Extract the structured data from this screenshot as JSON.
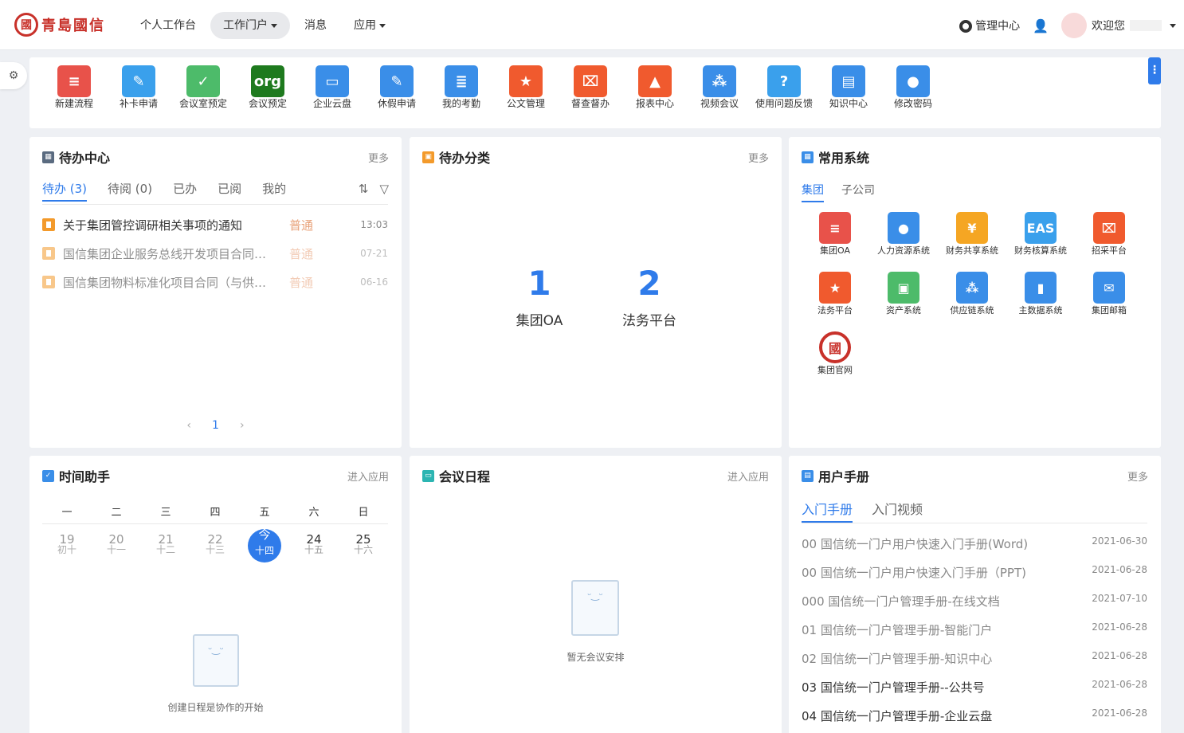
{
  "brand": {
    "seal": "國",
    "name": "青島國信"
  },
  "nav": [
    {
      "label": "个人工作台"
    },
    {
      "label": "工作门户",
      "active": true,
      "dropdown": true
    },
    {
      "label": "消息"
    },
    {
      "label": "应用",
      "dropdown": true
    }
  ],
  "top_right": {
    "admin": "管理中心",
    "welcome": "欢迎您"
  },
  "shortcuts": [
    {
      "label": "新建流程",
      "color": "#e8524a",
      "icon": "≡"
    },
    {
      "label": "补卡申请",
      "color": "#3aa0ec",
      "icon": "✎"
    },
    {
      "label": "会议室预定",
      "color": "#4dbb6a",
      "icon": "✓"
    },
    {
      "label": "会议预定",
      "color": "#1e7a1e",
      "icon": "org"
    },
    {
      "label": "企业云盘",
      "color": "#3a8ee8",
      "icon": "▭"
    },
    {
      "label": "休假申请",
      "color": "#3a8ee8",
      "icon": "✎"
    },
    {
      "label": "我的考勤",
      "color": "#3a8ee8",
      "icon": "≣"
    },
    {
      "label": "公文管理",
      "color": "#f05a2e",
      "icon": "★"
    },
    {
      "label": "督查督办",
      "color": "#f05a2e",
      "icon": "⌧"
    },
    {
      "label": "报表中心",
      "color": "#f05a2e",
      "icon": "▲"
    },
    {
      "label": "视频会议",
      "color": "#3a8ee8",
      "icon": "⁂"
    },
    {
      "label": "使用问题反馈",
      "color": "#3aa0ec",
      "icon": "?"
    },
    {
      "label": "知识中心",
      "color": "#3a8ee8",
      "icon": "▤"
    },
    {
      "label": "修改密码",
      "color": "#3a8ee8",
      "icon": "●"
    }
  ],
  "todo": {
    "title": "待办中心",
    "more": "更多",
    "tabs": [
      "待办 (3)",
      "待阅 (0)",
      "已办",
      "已阅",
      "我的"
    ],
    "rows": [
      {
        "text": "关于集团管控调研相关事项的通知",
        "level": "普通",
        "time": "13:03"
      },
      {
        "text": "国信集团企业服务总线开发项目合同执行情况",
        "level": "普通",
        "time": "07-21"
      },
      {
        "text": "国信集团物料标准化项目合同（与供应商签订）",
        "level": "普通",
        "time": "06-16"
      }
    ],
    "page": "1"
  },
  "category": {
    "title": "待办分类",
    "more": "更多",
    "items": [
      {
        "count": "1",
        "name": "集团OA"
      },
      {
        "count": "2",
        "name": "法务平台"
      }
    ]
  },
  "systems": {
    "title": "常用系统",
    "tabs": [
      "集团",
      "子公司"
    ],
    "items": [
      {
        "label": "集团OA",
        "color": "#e8524a",
        "icon": "≡"
      },
      {
        "label": "人力资源系统",
        "color": "#3a8ee8",
        "icon": "●"
      },
      {
        "label": "财务共享系统",
        "color": "#f5a623",
        "icon": "¥"
      },
      {
        "label": "财务核算系统",
        "color": "#3aa0ec",
        "icon": "EAS"
      },
      {
        "label": "招采平台",
        "color": "#f05a2e",
        "icon": "⌧"
      },
      {
        "label": "法务平台",
        "color": "#f05a2e",
        "icon": "★"
      },
      {
        "label": "资产系统",
        "color": "#4dbb6a",
        "icon": "▣"
      },
      {
        "label": "供应链系统",
        "color": "#3a8ee8",
        "icon": "⁂"
      },
      {
        "label": "主数据系统",
        "color": "#3a8ee8",
        "icon": "▮"
      },
      {
        "label": "集团邮箱",
        "color": "#3a8ee8",
        "icon": "✉"
      },
      {
        "label": "集团官网",
        "color": "#c8312a",
        "icon": "國",
        "seal": true
      }
    ]
  },
  "time": {
    "title": "时间助手",
    "more": "进入应用",
    "weekdays": [
      "一",
      "二",
      "三",
      "四",
      "五",
      "六",
      "日"
    ],
    "days": [
      {
        "d": "19",
        "l": "初十"
      },
      {
        "d": "20",
        "l": "十一"
      },
      {
        "d": "21",
        "l": "十二"
      },
      {
        "d": "22",
        "l": "十三"
      },
      {
        "d": "今",
        "l": "十四",
        "today": true
      },
      {
        "d": "24",
        "l": "十五",
        "future": true
      },
      {
        "d": "25",
        "l": "十六",
        "future": true
      }
    ],
    "empty": "创建日程是协作的开始"
  },
  "meeting": {
    "title": "会议日程",
    "more": "进入应用",
    "empty": "暂无会议安排"
  },
  "manual": {
    "title": "用户手册",
    "more": "更多",
    "tabs": [
      "入门手册",
      "入门视频"
    ],
    "rows": [
      {
        "text": "00 国信统一门户用户快速入门手册(Word)",
        "date": "2021-06-30"
      },
      {
        "text": "00 国信统一门户用户快速入门手册（PPT)",
        "date": "2021-06-28"
      },
      {
        "text": "000 国信统一门户管理手册-在线文档",
        "date": "2021-07-10"
      },
      {
        "text": "01 国信统一门户管理手册-智能门户",
        "date": "2021-06-28"
      },
      {
        "text": "02 国信统一门户管理手册-知识中心",
        "date": "2021-06-28"
      },
      {
        "text": "03 国信统一门户管理手册--公共号",
        "date": "2021-06-28",
        "dark": true
      },
      {
        "text": "04 国信统一门户管理手册-企业云盘",
        "date": "2021-06-28",
        "dark": true
      }
    ]
  },
  "colors": {
    "accent": "#2f7bea",
    "brand": "#c8312a"
  }
}
